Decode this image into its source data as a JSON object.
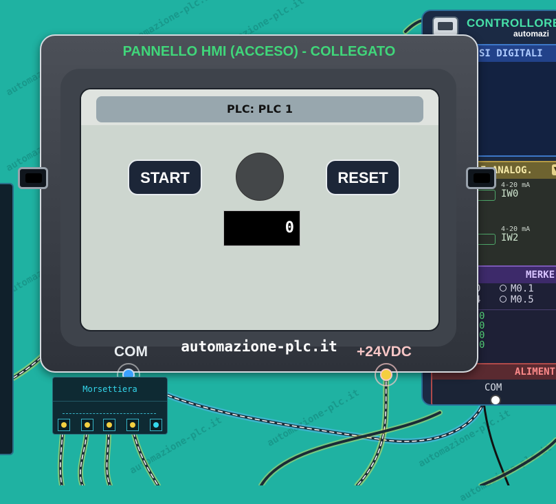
{
  "hmi": {
    "title": "PANNELLO HMI (ACCESO) - COLLEGATO",
    "screen_header": "PLC: PLC 1",
    "start_label": "START",
    "reset_label": "RESET",
    "counter_value": "0",
    "lamp_state": "off",
    "brand": "automazione-plc.it",
    "terminal_com": "COM",
    "terminal_24v": "+24VDC"
  },
  "plc": {
    "title": "CONTROLLORE",
    "subtitle": "automazi",
    "digital_section": "SI DIGITALI",
    "analog_section": "I ANALOG.",
    "analog_inputs": [
      {
        "unit": "4-20 mA",
        "name": "IW0"
      },
      {
        "unit": "4-20 mA",
        "name": "IW2"
      }
    ],
    "merker_section": "MERKE",
    "merkers": [
      {
        "left": "0",
        "name": "M0.1"
      },
      {
        "left": "4",
        "name": "M0.5"
      }
    ],
    "merker_values": [
      "0",
      "0",
      "0",
      "0"
    ],
    "power_section": "ALIMENT",
    "power_com": "COM"
  },
  "morsettiera": {
    "title": "Morsettiera",
    "terminal_count": 5
  },
  "watermark": "automazione-plc.it",
  "colors": {
    "background": "#1fb2a2",
    "hmi_title": "#40d67a",
    "plc_title": "#47e0a8",
    "terminal_24v": "#f7c6c6",
    "terminal_com": "#e8ecef"
  }
}
